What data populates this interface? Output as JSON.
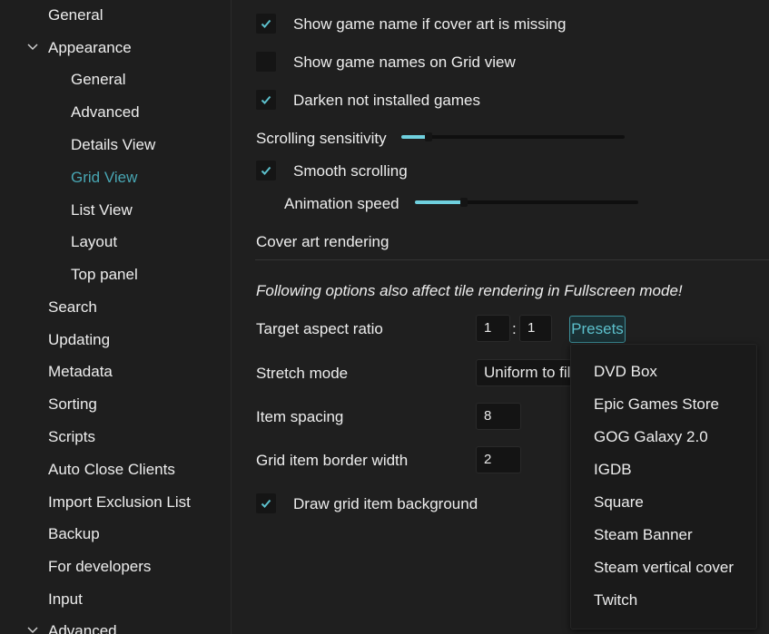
{
  "sidebar": {
    "items": [
      {
        "label": "General"
      },
      {
        "label": "Appearance"
      },
      {
        "label": "General"
      },
      {
        "label": "Advanced"
      },
      {
        "label": "Details View"
      },
      {
        "label": "Grid View"
      },
      {
        "label": "List View"
      },
      {
        "label": "Layout"
      },
      {
        "label": "Top panel"
      },
      {
        "label": "Search"
      },
      {
        "label": "Updating"
      },
      {
        "label": "Metadata"
      },
      {
        "label": "Sorting"
      },
      {
        "label": "Scripts"
      },
      {
        "label": "Auto Close Clients"
      },
      {
        "label": "Import Exclusion List"
      },
      {
        "label": "Backup"
      },
      {
        "label": "For developers"
      },
      {
        "label": "Input"
      },
      {
        "label": "Advanced"
      }
    ],
    "selected": "Grid View",
    "icons": {
      "expand": "chevron-down-icon"
    }
  },
  "settings": {
    "show_game_name_missing_cover": {
      "label": "Show game name if cover art is missing",
      "checked": true
    },
    "show_game_names_grid": {
      "label": "Show game names on Grid view",
      "checked": false
    },
    "darken_not_installed": {
      "label": "Darken not installed games",
      "checked": true
    },
    "scrolling_sensitivity": {
      "label": "Scrolling sensitivity",
      "level": 0.12
    },
    "smooth_scrolling": {
      "label": "Smooth scrolling",
      "checked": true
    },
    "animation_speed": {
      "label": "Animation speed",
      "level": 0.22
    },
    "cover_art_rendering": {
      "label": "Cover art rendering"
    },
    "fullscreen_note": "Following options also affect tile rendering in Fullscreen mode!",
    "target_aspect_ratio": {
      "label": "Target aspect ratio",
      "width": "1",
      "separator": ":",
      "height": "1",
      "presets_label": "Presets"
    },
    "stretch_mode": {
      "label": "Stretch mode",
      "value": "Uniform to fill"
    },
    "item_spacing": {
      "label": "Item spacing",
      "value": "8"
    },
    "grid_item_border_width": {
      "label": "Grid item border width",
      "value": "2"
    },
    "draw_grid_item_background": {
      "label": "Draw grid item background",
      "checked": true
    }
  },
  "presets_menu": {
    "items": [
      "DVD Box",
      "Epic Games Store",
      "GOG Galaxy 2.0",
      "IGDB",
      "Square",
      "Steam Banner",
      "Steam vertical cover",
      "Twitch"
    ]
  },
  "colors": {
    "accent": "#48a6b3",
    "slider_fill": "#6fd0de",
    "background": "#1f1f1f"
  }
}
